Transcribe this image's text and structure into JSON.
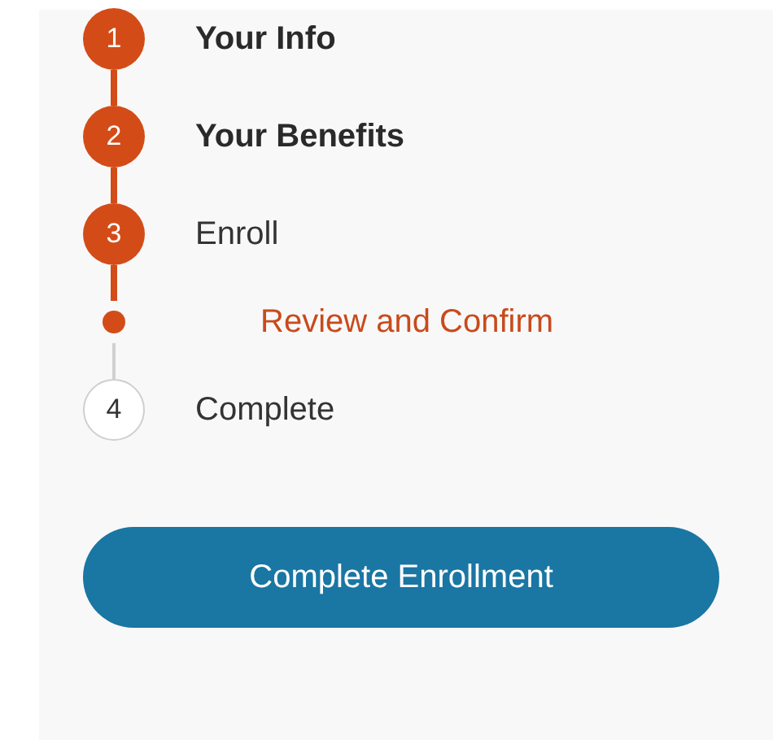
{
  "steps": [
    {
      "kind": "step",
      "number": "1",
      "label": "Your Info",
      "reached": true,
      "completed": true
    },
    {
      "kind": "step",
      "number": "2",
      "label": "Your Benefits",
      "reached": true,
      "completed": true
    },
    {
      "kind": "step",
      "number": "3",
      "label": "Enroll",
      "reached": true,
      "completed": false
    },
    {
      "kind": "substep",
      "label": "Review and Confirm",
      "reached": true
    },
    {
      "kind": "step",
      "number": "4",
      "label": "Complete",
      "reached": false,
      "completed": false
    }
  ],
  "button": {
    "label": "Complete Enrollment"
  }
}
